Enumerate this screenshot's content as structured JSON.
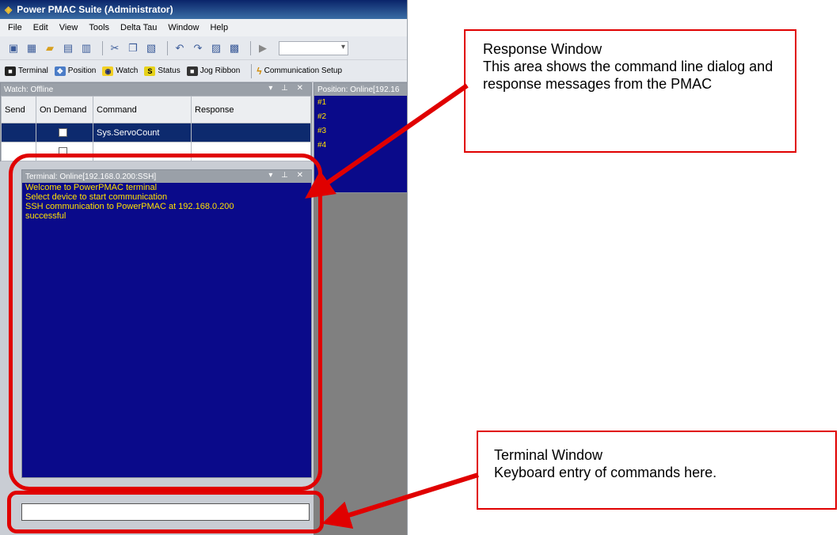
{
  "window": {
    "title": "Power PMAC Suite (Administrator)"
  },
  "menu": [
    "File",
    "Edit",
    "View",
    "Tools",
    "Delta Tau",
    "Window",
    "Help"
  ],
  "toolbar_secondary": [
    {
      "icon": "terminal-icon",
      "label": "Terminal"
    },
    {
      "icon": "position-icon",
      "label": "Position"
    },
    {
      "icon": "watch-icon",
      "label": "Watch"
    },
    {
      "icon": "status-icon",
      "label": "Status"
    },
    {
      "icon": "jog-icon",
      "label": "Jog Ribbon"
    },
    {
      "icon": "communication-icon",
      "label": "Communication Setup"
    }
  ],
  "watch": {
    "title": "Watch: Offline",
    "columns": [
      "Send",
      "On Demand",
      "Command",
      "Response"
    ],
    "rows": [
      {
        "command": "Sys.ServoCount",
        "response": ""
      },
      {
        "command": "",
        "response": ""
      }
    ]
  },
  "position": {
    "title": "Position: Online[192.16",
    "motors": [
      "#1",
      "#2",
      "#3",
      "#4"
    ]
  },
  "terminal": {
    "title": "Terminal: Online[192.168.0.200:SSH]",
    "lines": [
      "Welcome to PowerPMAC terminal",
      "Select device to start communication",
      "SSH communication to PowerPMAC at 192.168.0.200",
      "successful"
    ],
    "input_value": ""
  },
  "annotations": {
    "response": {
      "title": "Response Window",
      "text": "This area shows the command line dialog and response messages from the PMAC"
    },
    "terminal": {
      "title": "Terminal Window",
      "text": "Keyboard entry of commands here."
    }
  },
  "colors": {
    "accent_red": "#e00000",
    "terminal_bg": "#0a0a8a",
    "terminal_text": "#ffe000"
  }
}
